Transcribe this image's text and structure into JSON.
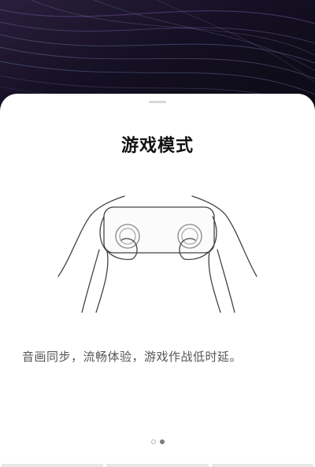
{
  "sheet": {
    "title": "游戏模式",
    "description": "音画同步，流畅体验，游戏作战低时延。"
  },
  "illustration": {
    "icon": "hands-holding-phone-landscape-icon"
  },
  "pager": {
    "total_pages": 2,
    "current_page": 2
  },
  "colors": {
    "wallpaper_base": "#0b0b14",
    "wallpaper_accent_purple": "#6a4a8c",
    "sheet_background": "#ffffff",
    "title": "#111111",
    "description": "#555555",
    "dot_active": "#7a7a7a",
    "dot_inactive": "#b3b3b3"
  }
}
